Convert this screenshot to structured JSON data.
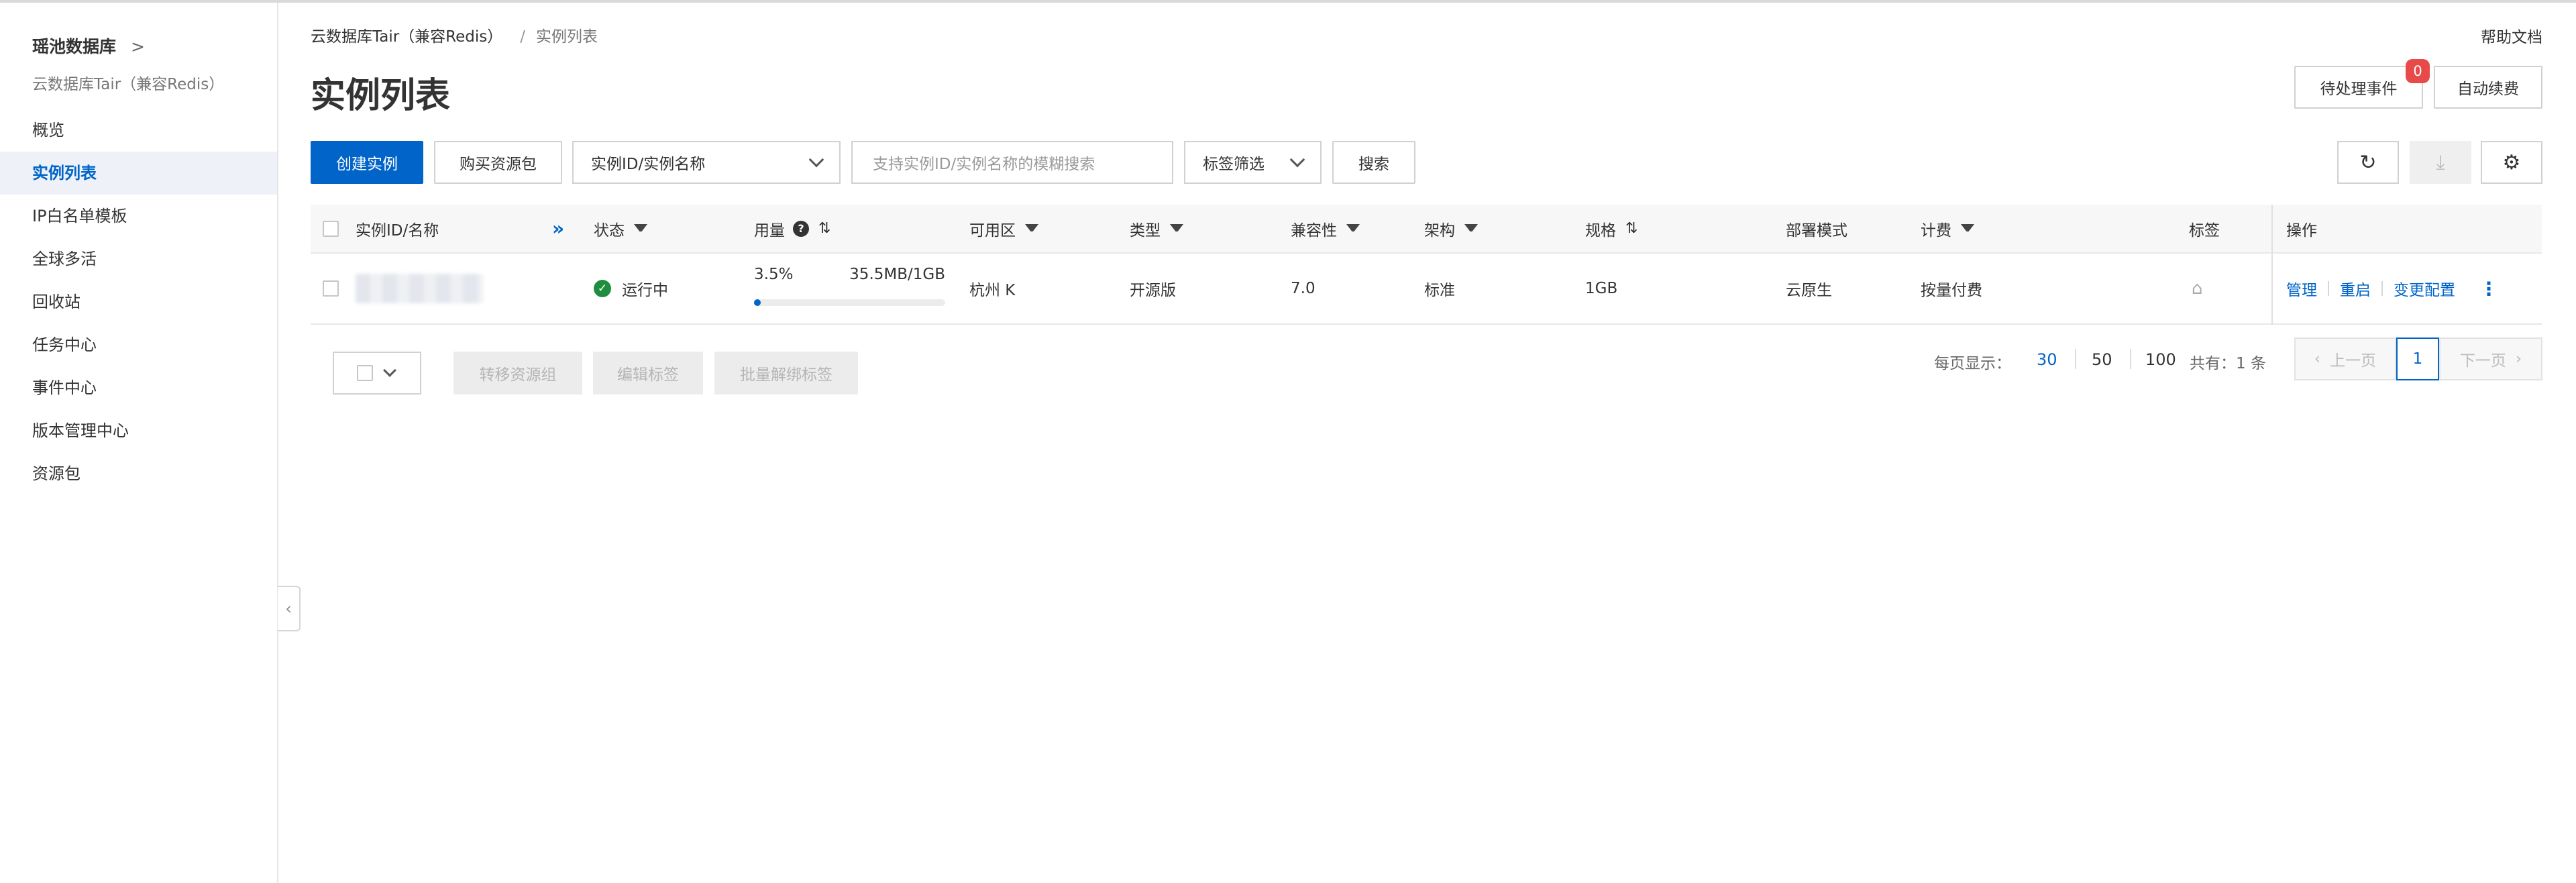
{
  "sidebar": {
    "product": "瑶池数据库",
    "chevron": ">",
    "subtitle": "云数据库Tair（兼容Redis）",
    "items": [
      {
        "label": "概览"
      },
      {
        "label": "实例列表"
      },
      {
        "label": "IP白名单模板"
      },
      {
        "label": "全球多活"
      },
      {
        "label": "回收站"
      },
      {
        "label": "任务中心"
      },
      {
        "label": "事件中心"
      },
      {
        "label": "版本管理中心"
      },
      {
        "label": "资源包"
      }
    ],
    "active_index": 1
  },
  "breadcrumb": {
    "parent": "云数据库Tair（兼容Redis）",
    "sep": "/",
    "current": "实例列表"
  },
  "help_link": "帮助文档",
  "page_title": "实例列表",
  "header_buttons": {
    "pending": "待处理事件",
    "pending_count": "0",
    "auto_renew": "自动续费"
  },
  "toolbar": {
    "create": "创建实例",
    "buy_package": "购买资源包",
    "search_field_select": "实例ID/实例名称",
    "search_placeholder": "支持实例ID/实例名称的模糊搜索",
    "tag_filter": "标签筛选",
    "search": "搜索"
  },
  "icons": {
    "refresh": "refresh-icon",
    "download": "download-icon",
    "settings": "gear-icon"
  },
  "table": {
    "headers": {
      "id": "实例ID/名称",
      "status": "状态",
      "usage": "用量",
      "zone": "可用区",
      "type": "类型",
      "compat": "兼容性",
      "arch": "架构",
      "spec": "规格",
      "deploy": "部署模式",
      "billing": "计费",
      "tags": "标签",
      "ops": "操作"
    },
    "rows": [
      {
        "status": "运行中",
        "usage_percent": "3.5%",
        "usage_fraction": 0.035,
        "usage_amount": "35.5MB/1GB",
        "zone": "杭州 K",
        "type": "开源版",
        "compat": "7.0",
        "arch": "标准",
        "spec": "1GB",
        "deploy": "云原生",
        "billing": "按量付费",
        "ops": {
          "manage": "管理",
          "restart": "重启",
          "change": "变更配置"
        }
      }
    ]
  },
  "footer": {
    "move_group": "转移资源组",
    "edit_tags": "编辑标签",
    "unbind_tags": "批量解绑标签",
    "page_size_label": "每页显示：",
    "page_sizes": [
      "30",
      "50",
      "100"
    ],
    "total": "共有：1 条",
    "prev": "上一页",
    "page": "1",
    "next": "下一页"
  }
}
